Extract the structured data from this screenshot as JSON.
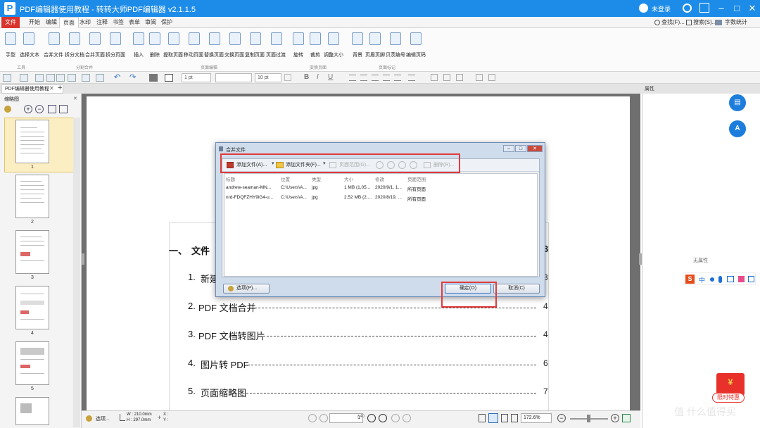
{
  "app": {
    "title": "PDF编辑器使用教程 - 转转大师PDF编辑器 v2.1.1.5",
    "logo": "P",
    "user_label": "未登录",
    "window_buttons": [
      "–",
      "□",
      "✕"
    ]
  },
  "menu": {
    "tabs": [
      "文件",
      "开始",
      "编辑",
      "页面",
      "水印",
      "注释",
      "书签",
      "表单",
      "审阅",
      "保护"
    ],
    "active": "页面",
    "right_links": [
      "查找(F)...",
      "搜索(S)...",
      "字数统计"
    ]
  },
  "ribbon": {
    "buttons": [
      "手型",
      "选择文本",
      "合并文件",
      "拆分文档",
      "合并页面",
      "拆分页面",
      "插入",
      "删除",
      "提取页面",
      "移动页面",
      "替换页面",
      "交换页面",
      "复制页面",
      "页面过渡",
      "旋转",
      "裁剪",
      "调整大小",
      "背景",
      "页眉页脚",
      "贝茨编号",
      "编辑页码"
    ],
    "groups": [
      "工具",
      "分割合并",
      "页面编辑",
      "变换页面",
      "页面标记"
    ]
  },
  "format_bar": {
    "line_width": "1 pt",
    "font_size": "10 pt",
    "bold": "B",
    "italic": "I",
    "underline": "U"
  },
  "document_tab": "PDF编辑器使用教程",
  "right_panel": {
    "title": "属性",
    "empty_text": "无属性",
    "ime_brand": "S",
    "ime_lang": "中",
    "promo_badge": "¥",
    "promo_text": "限时特惠"
  },
  "thumbnails": {
    "title": "缩略图",
    "pages": [
      "1",
      "2",
      "3",
      "4",
      "5"
    ]
  },
  "document": {
    "heading_number": "一、",
    "heading_text": "文件",
    "toc": [
      {
        "num": "1.",
        "text": "新建",
        "page": "3"
      },
      {
        "num": "2.",
        "text": "PDF 文档合并",
        "page": "4"
      },
      {
        "num": "3.",
        "text": "PDF 文档转图片",
        "page": "4"
      },
      {
        "num": "4.",
        "text": "图片转 PDF",
        "page": "6"
      },
      {
        "num": "5.",
        "text": "页面缩略图",
        "page": "7"
      }
    ]
  },
  "status": {
    "select_label": "选项...",
    "width": "W : 210.0mm",
    "height": "H : 297.0mm",
    "x": "X :",
    "y": "Y :",
    "page_input": "1",
    "page_total": "/ 40",
    "zoom": "172.6%"
  },
  "dialog": {
    "title": "合并文件",
    "toolbar": {
      "add_file": "添加文件(A)...",
      "add_folder": "添加文件夹(F)...",
      "page_range": "页面范围(G)...",
      "delete": "删除(R)..."
    },
    "columns": [
      "标题",
      "位置",
      "类型",
      "大小",
      "修改",
      "页面范围"
    ],
    "rows": [
      [
        "andrew-seaman-MN...",
        "C:\\Users\\A...",
        "jpg",
        "1 MB (1,05...",
        "2020/9/1, 1...",
        "所有页面"
      ],
      [
        "nrd-FDQFZHY9iG4-u...",
        "C:\\Users\\A...",
        "jpg",
        "2.52 MB (2,...",
        "2020/8/19, ...",
        "所有页面"
      ]
    ],
    "options_button": "选项(P)...",
    "ok_button": "确定(O)",
    "cancel_button": "取消(C)"
  },
  "watermark": "值 什么值得买",
  "colors": {
    "brand_blue": "#1d8ce8",
    "file_tab_red": "#d9352f",
    "highlight_red": "#e23b3b"
  }
}
